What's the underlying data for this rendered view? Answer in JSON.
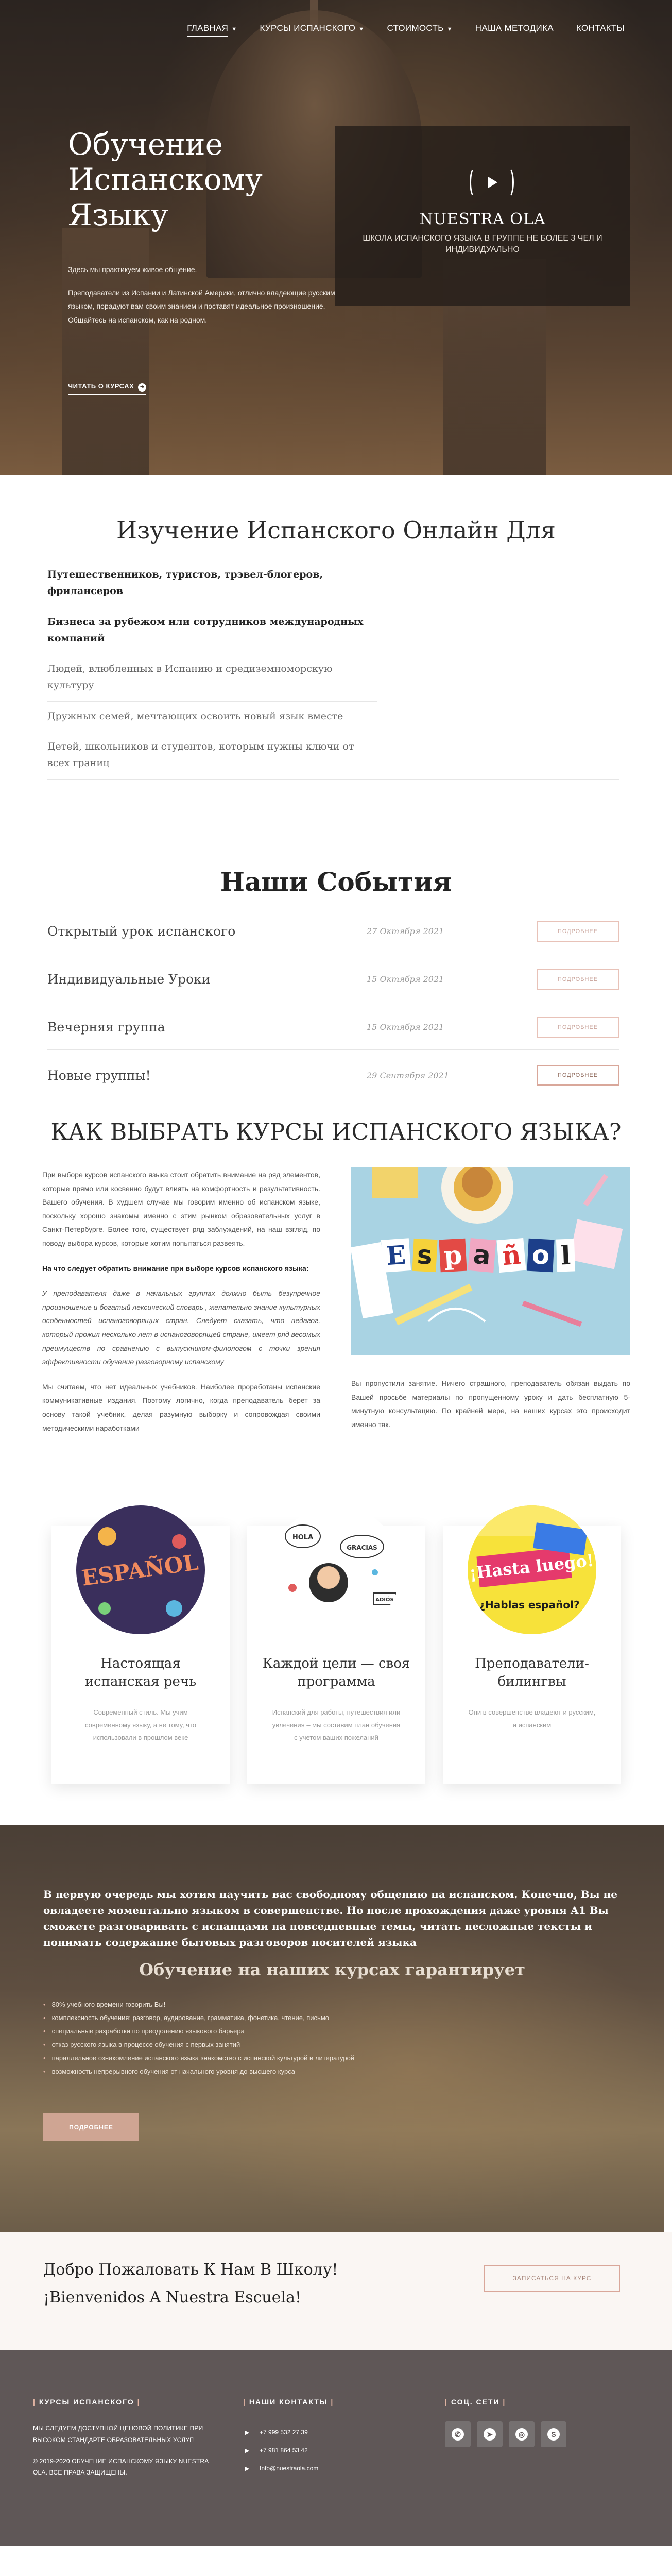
{
  "nav": {
    "items": [
      {
        "label": "ГЛАВНАЯ",
        "dropdown": true,
        "active": true
      },
      {
        "label": "КУРСЫ ИСПАНСКОГО",
        "dropdown": true
      },
      {
        "label": "СТОИМОСТЬ",
        "dropdown": true
      },
      {
        "label": "НАША МЕТОДИКА",
        "dropdown": false
      },
      {
        "label": "КОНТАКТЫ",
        "dropdown": false
      }
    ]
  },
  "hero": {
    "title": "Обучение Испанскому Языку",
    "para1": "Здесь мы практикуем живое общение.",
    "para2": "Преподаватели из Испании и Латинской Америки, отлично владеющие русским языком, порадуют вам своим знанием и поставят идеальное произношение. Общайтесь на испанском, как на родном.",
    "link": "ЧИТАТЬ О КУРСАХ",
    "video_title": "NUESTRA OLA",
    "video_sub": "ШКОЛА ИСПАНСКОГО ЯЗЫКА В ГРУППЕ НЕ БОЛЕЕ 3 ЧЕЛ И ИНДИВИДУАЛЬНО"
  },
  "study": {
    "title": "Изучение Испанского Онлайн Для",
    "items": [
      "Путешественников, туристов, трэвел-блогеров, фрилансеров",
      "Бизнеса за рубежом или сотрудников международных компаний",
      "Людей, влюбленных в Испанию и средиземноморскую культуру",
      "Дружных семей, мечтающих освоить новый язык вместе",
      "Детей, школьников и студентов, которым нужны ключи от всех границ"
    ]
  },
  "events": {
    "title": "Наши События",
    "items": [
      {
        "name": "Открытый урок испанского",
        "date": "27 Октября 2021",
        "button": "ПОДРОБНЕЕ"
      },
      {
        "name": "Индивидуальные Уроки",
        "date": "15 Октября 2021",
        "button": "ПОДРОБНЕЕ"
      },
      {
        "name": "Вечерняя группа",
        "date": "15 Октября 2021",
        "button": "ПОДРОБНЕЕ"
      },
      {
        "name": "Новые группы!",
        "date": "29 Сентября 2021",
        "button": "ПОДРОБНЕЕ"
      }
    ]
  },
  "choose": {
    "title": "КАК ВЫБРАТЬ КУРСЫ ИСПАНСКОГО ЯЗЫКА?",
    "p1": "При выборе курсов испанского языка стоит обратить внимание на ряд элементов, которые прямо или косвенно будут влиять на комфортность и результативность. Вашего обучения. В худшем случае мы говорим именно об испанском языке, поскольку хорошо знакомы именно с этим рынком образовательных услуг в Санкт-Петербурге. Более того, существует ряд заблуждений, на наш взгляд, по поводу выбора курсов, которые хотим попытаться развеять.",
    "p2": "На что следует обратить внимание при выборе курсов испанского языка:",
    "p3": "У преподавателя даже в начальных группах должно быть безупречное произношение и богатый лексический словарь , желательно знание культурных особенностей испаноговорящих стран. Следует сказать, что педагог, который прожил несколько лет в испаноговорящей стране, имеет ряд весомых преимуществ по сравнению с выпускником-филологом с точки зрения эффективности обучение разговорному испанскому",
    "p4": "Мы считаем, что нет идеальных учебников. Наиболее проработаны испанские коммуникативные издания. Поэтому логично, когда преподаватель берет за основу такой учебник, делая разумную выборку и сопровождая своими методическими наработками",
    "image_word": "ESPAÑOL",
    "right_text": "Вы пропустили занятие. Ничего страшного, преподаватель обязан выдать по Вашей просьбе материалы по пропущенному уроку и дать бесплатную 5-минутную консультацию. По крайней мере, на наших курсах это происходит именно так."
  },
  "cards": [
    {
      "title": "Настоящая испанская речь",
      "text": "Современный стиль. Мы учим современному языку, а не тому, что использовали в прошлом веке",
      "image_word": "ESPAÑOL"
    },
    {
      "title": "Каждой цели — своя программа",
      "text": "Испанский для работы, путешествия или увлечения – мы составим план обучения с учетом ваших пожеланий",
      "image_words": [
        "HOLA",
        "GRACIAS",
        "ADIÓS"
      ]
    },
    {
      "title": "Преподаватели-билингвы",
      "text": "Они в совершенстве владеют и русским, и испанским",
      "image_words": [
        "¡Hasta luego!",
        "¿Hablas español?"
      ]
    }
  ],
  "guarantee": {
    "lead": "В первую очередь мы хотим научить вас свободному общению на испанском. Конечно, Вы не овладеете моментально языком в совершенстве. Но после прохождения даже уровня А1 Вы сможете разговаривать с испанцами на повседневные темы, читать несложные тексты и понимать содержание бытовых разговоров носителей языка",
    "title": "Обучение на наших курсах гарантирует",
    "items": [
      "80% учебного времени говорить Вы!",
      "комплексность обучения: разговор, аудирование, грамматика, фонетика, чтение, письмо",
      "специальные разработки по преодолению языкового барьера",
      "отказ русского языка в процессе обучения с первых занятий",
      "параллельное ознакомление испанского языка знакомство с испанской культурой и литературой",
      "возможность непрерывного обучения от начального уровня до высшего курса"
    ],
    "button": "ПОДРОБНЕЕ"
  },
  "welcome": {
    "line1": "Добро Пожаловать К Нам В Школу!",
    "line2": "¡Bienvenidos A Nuestra Escuela!",
    "button": "ЗАПИСАТЬСЯ НА КУРС"
  },
  "footer": {
    "col1_head": "КУРСЫ ИСПАНСКОГО",
    "col1_text": "МЫ СЛЕДУЕМ ДОСТУПНОЙ ЦЕНОВОЙ ПОЛИТИКЕ ПРИ ВЫСОКОМ СТАНДАРТЕ ОБРАЗОВАТЕЛЬНЫХ УСЛУГ!",
    "copyright": "© 2019-2020 ОБУЧЕНИЕ ИСПАНСКОМУ ЯЗЫКУ NUESTRA OLA. ВСЕ ПРАВА ЗАЩИЩЕНЫ.",
    "col2_head": "НАШИ КОНТАКТЫ",
    "phone1": "+7 999 532 27 39",
    "phone2": "+7 981 864 53 42",
    "email": "Info@nuestraola.com",
    "col3_head": "СОЦ. СЕТИ"
  }
}
